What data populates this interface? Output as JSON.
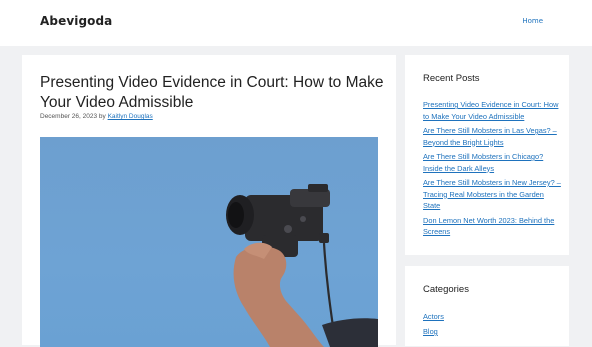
{
  "header": {
    "site_title": "Abevigoda",
    "nav": {
      "home_label": "Home"
    }
  },
  "article": {
    "title": "Presenting Video Evidence in Court: How to Make Your Video Admissible",
    "date": "December 26, 2023",
    "by_label": "by",
    "author": "Kaitlyn Douglas"
  },
  "sidebar": {
    "recent_posts": {
      "title": "Recent Posts",
      "items": [
        "Presenting Video Evidence in Court: How to Make Your Video Admissible",
        "Are There Still Mobsters in Las Vegas? – Beyond the Bright Lights",
        "Are There Still Mobsters in Chicago? Inside the Dark Alleys",
        "Are There Still Mobsters in New Jersey? – Tracing Real Mobsters in the Garden State",
        "Don Lemon Net Worth 2023: Behind the Screens"
      ]
    },
    "categories": {
      "title": "Categories",
      "items": [
        "Actors",
        "Blog"
      ]
    }
  },
  "colors": {
    "link": "#1e72bd",
    "page_background": "#f0f1f3",
    "sky": "#6ea3d4"
  }
}
